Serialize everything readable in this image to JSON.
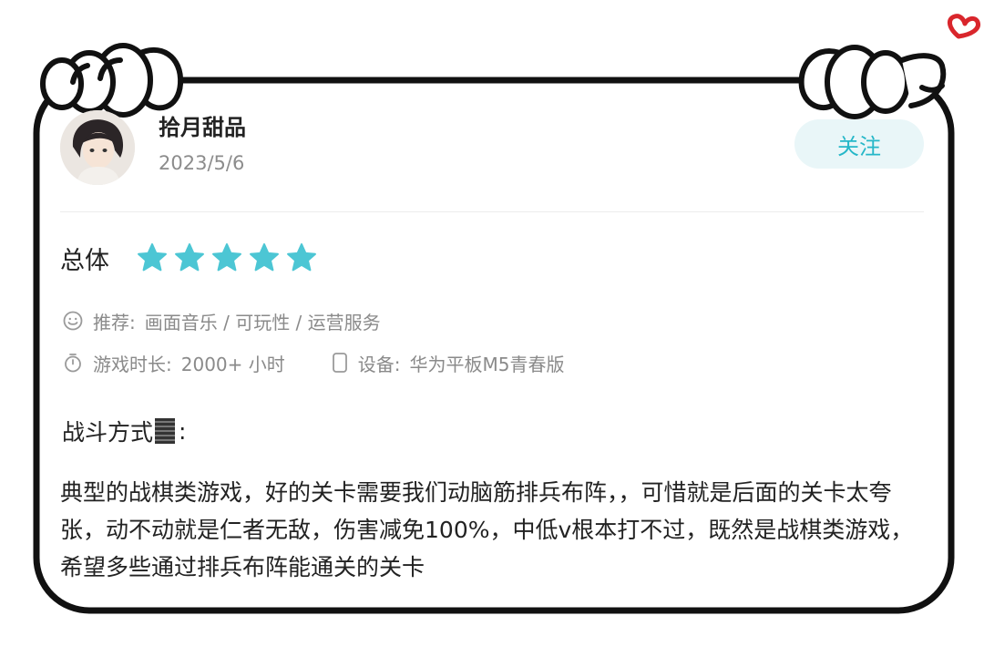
{
  "user": {
    "name": "拾月甜品",
    "date": "2023/5/6",
    "follow_label": "关注"
  },
  "rating": {
    "label": "总体",
    "stars": 5,
    "max": 5,
    "star_color": "#4cc6d4"
  },
  "meta": {
    "recommend_label": "推荐:",
    "recommend_value": "画面音乐 / 可玩性 / 运营服务",
    "playtime_label": "游戏时长:",
    "playtime_value": "2000+ 小时",
    "device_label": "设备:",
    "device_value": "华为平板M5青春版",
    "icons": [
      "smile-icon",
      "stopwatch-icon",
      "tablet-icon"
    ]
  },
  "review": {
    "section_title": "战斗方式",
    "section_suffix": ":",
    "body": "典型的战棋类游戏，好的关卡需要我们动脑筋排兵布阵，，可惜就是后面的关卡太夸张，动不动就是仁者无敌，伤害减免100%，中低v根本打不过，既然是战棋类游戏，希望多些通过排兵布阵能通关的关卡"
  },
  "decoration": {
    "heart_color": "#d9262c",
    "frame_color": "#111111"
  }
}
